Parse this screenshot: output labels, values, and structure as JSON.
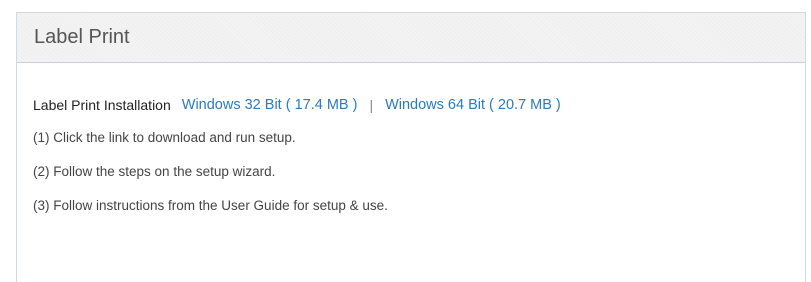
{
  "panel": {
    "title": "Label Print"
  },
  "install": {
    "label": "Label Print Installation",
    "separator": "|",
    "links": [
      {
        "label": "Windows 32 Bit ( 17.4 MB )"
      },
      {
        "label": "Windows 64 Bit ( 20.7 MB )"
      }
    ]
  },
  "steps": [
    "(1) Click the link to download and run setup.",
    "(2) Follow the steps on the setup wizard.",
    "(3) Follow instructions from the User Guide for setup & use."
  ],
  "colors": {
    "link": "#2a7bbf",
    "header_background": "#f3f3f3",
    "border": "#cfd8e3"
  }
}
